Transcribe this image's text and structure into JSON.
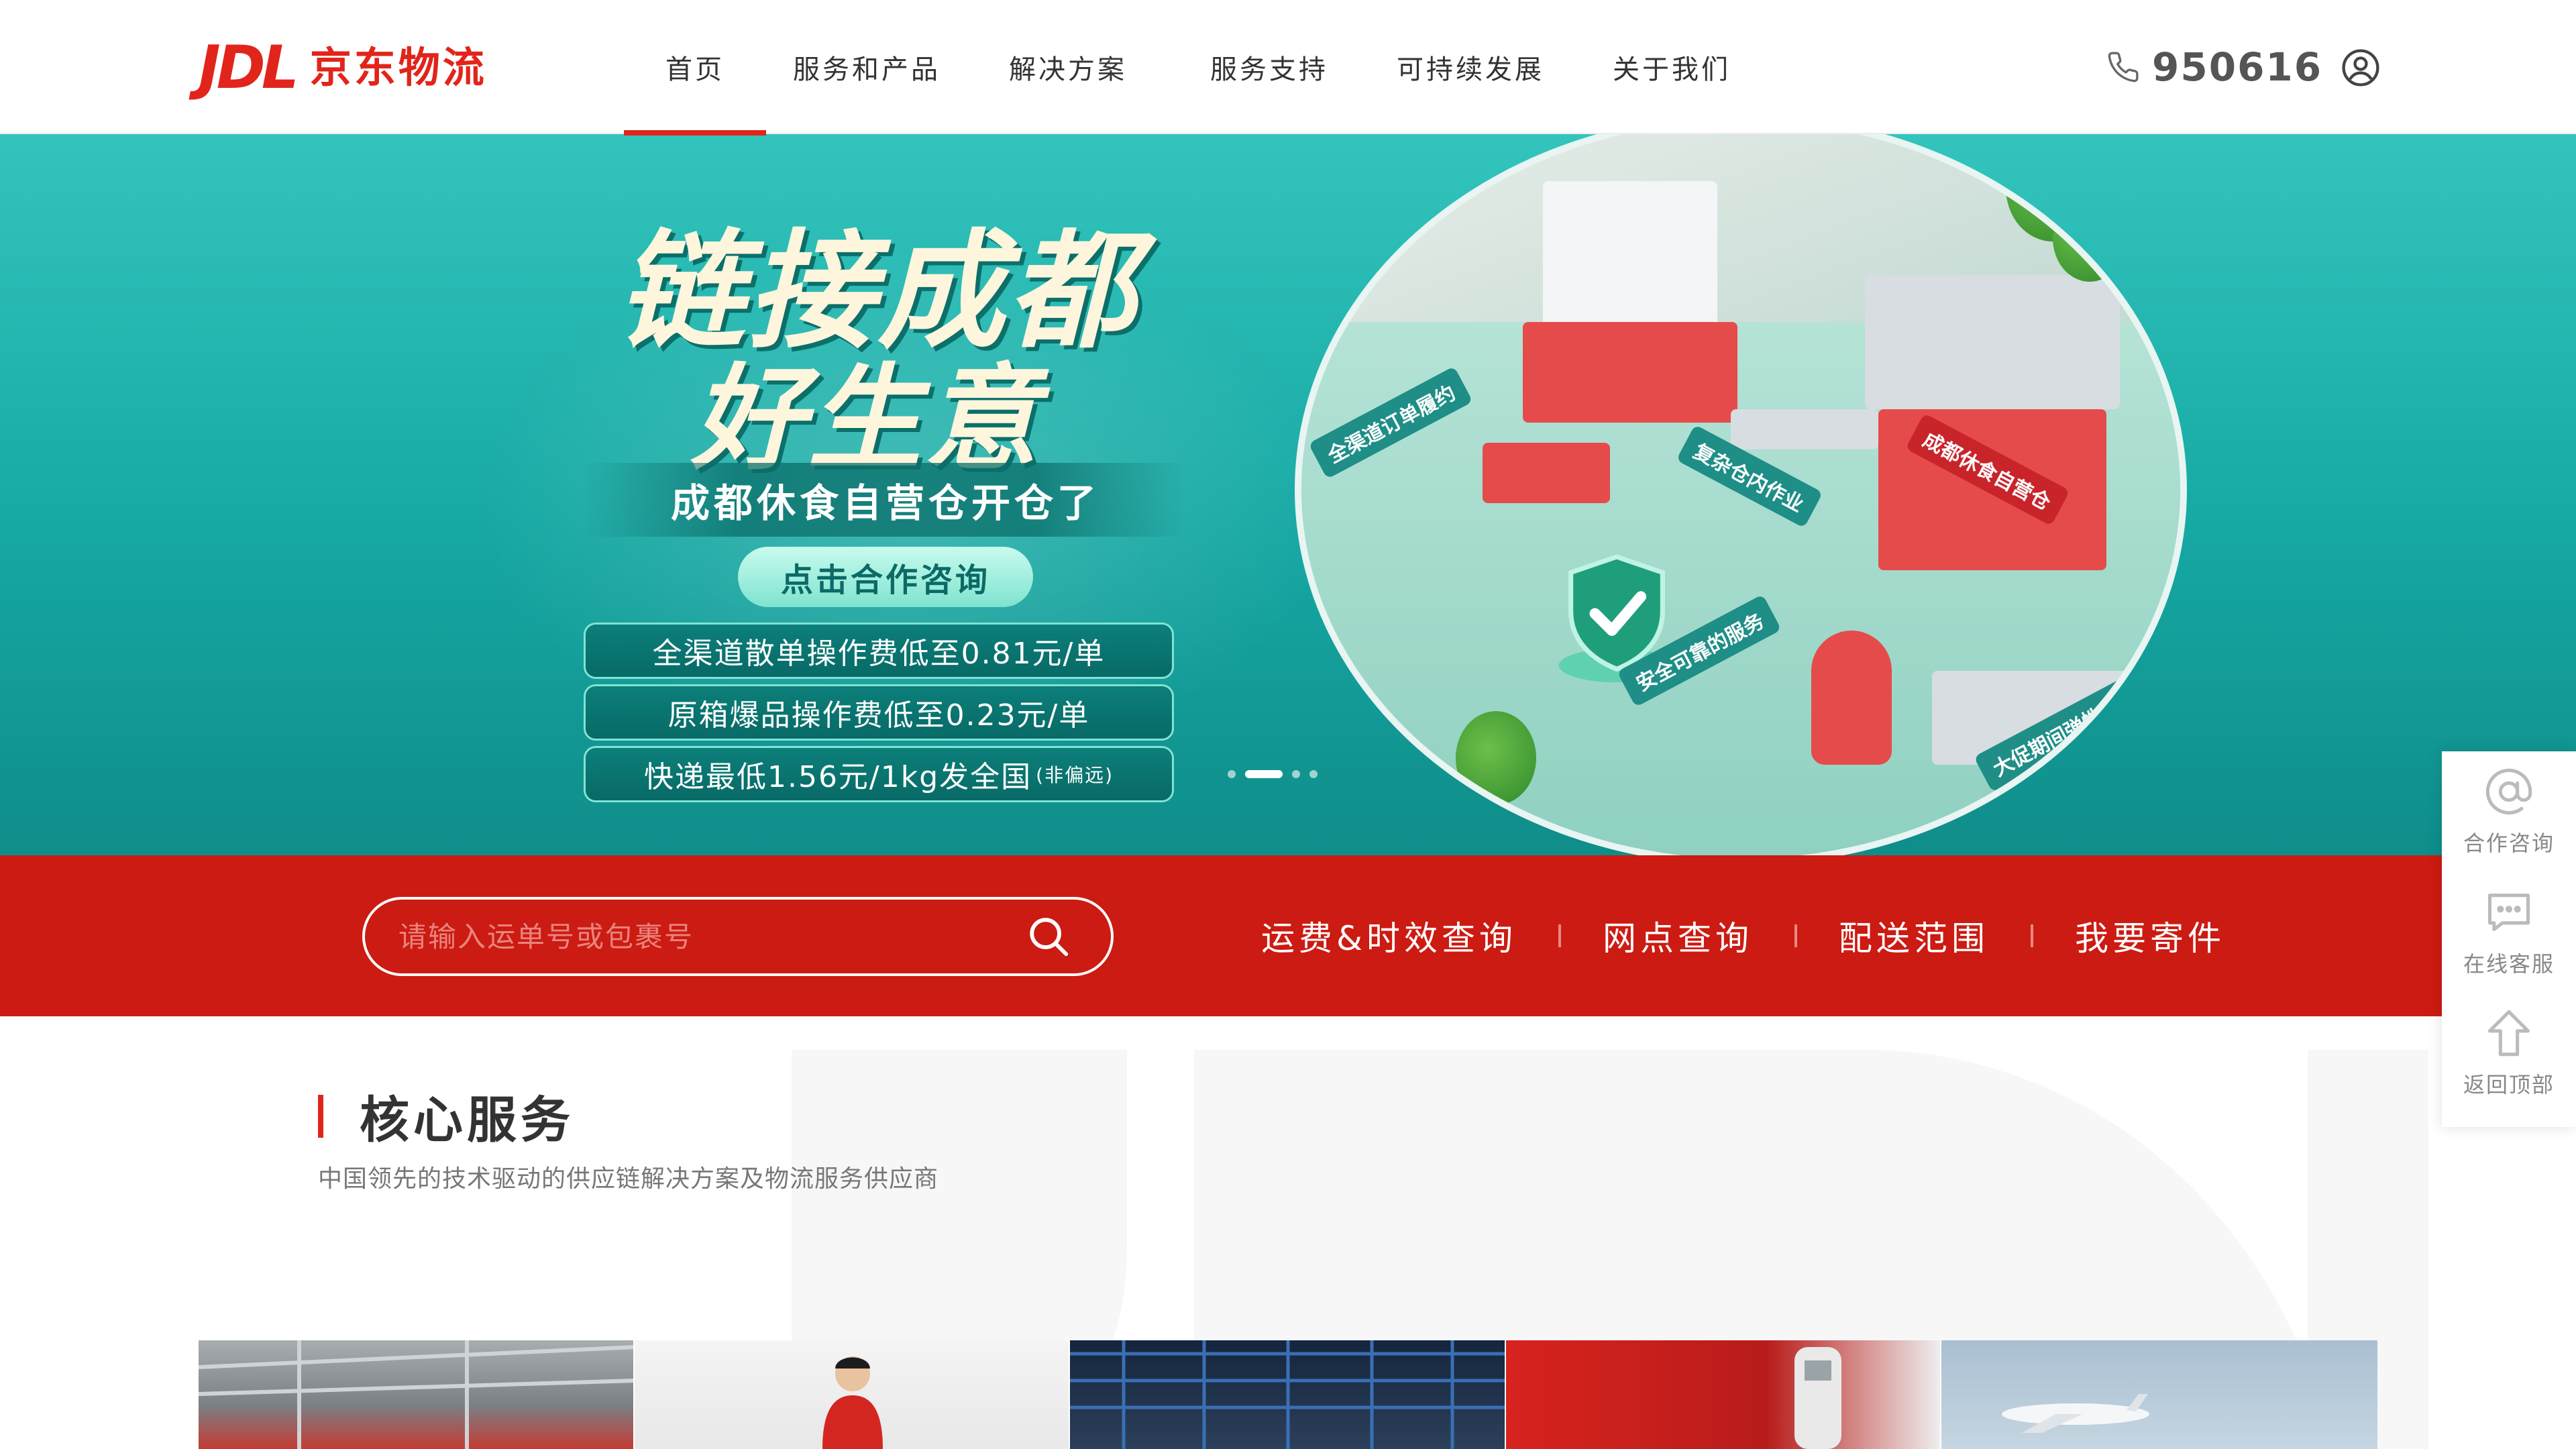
{
  "header": {
    "logo_mark": "JDL",
    "logo_text": "京东物流",
    "nav": [
      {
        "label": "首页",
        "active": true
      },
      {
        "label": "服务和产品",
        "active": false
      },
      {
        "label": "解决方案",
        "active": false
      },
      {
        "label": "服务支持",
        "active": false
      },
      {
        "label": "可持续发展",
        "active": false
      },
      {
        "label": "关于我们",
        "active": false
      }
    ],
    "phone": "950616",
    "icons": {
      "phone": "phone-icon",
      "user": "user-icon"
    }
  },
  "banner": {
    "headline_1": "链接成都",
    "headline_2": "好生意",
    "subtitle": "成都休食自营仓开仓了",
    "cta": "点击合作咨询",
    "prices": [
      {
        "text": "全渠道散单操作费低至0.81元/单",
        "note": ""
      },
      {
        "text": "原箱爆品操作费低至0.23元/单",
        "note": ""
      },
      {
        "text": "快递最低1.56元/1kg发全国",
        "note": "(非偏远)"
      }
    ],
    "scene_tags": [
      "全渠道订单履约",
      "复杂仓内作业",
      "成都休食自营仓",
      "安全可靠的服务",
      "大促期间弹性产能"
    ],
    "slides": {
      "count": 4,
      "active": 1
    },
    "colors": {
      "bg": "#1aaea8",
      "headline": "#fdf6dc",
      "accent": "#e1251b"
    }
  },
  "search": {
    "placeholder": "请输入运单号或包裹号",
    "value": "",
    "links": [
      "运费&时效查询",
      "网点查询",
      "配送范围",
      "我要寄件"
    ]
  },
  "side_panel": [
    {
      "label": "合作咨询",
      "icon": "at-icon"
    },
    {
      "label": "在线客服",
      "icon": "chat-icon"
    },
    {
      "label": "返回顶部",
      "icon": "arrow-up-icon"
    }
  ],
  "core": {
    "title": "核心服务",
    "subtitle": "中国领先的技术驱动的供应链解决方案及物流服务供应商"
  },
  "brand": {
    "red": "#e1251b",
    "bar_red": "#cc1b12"
  }
}
